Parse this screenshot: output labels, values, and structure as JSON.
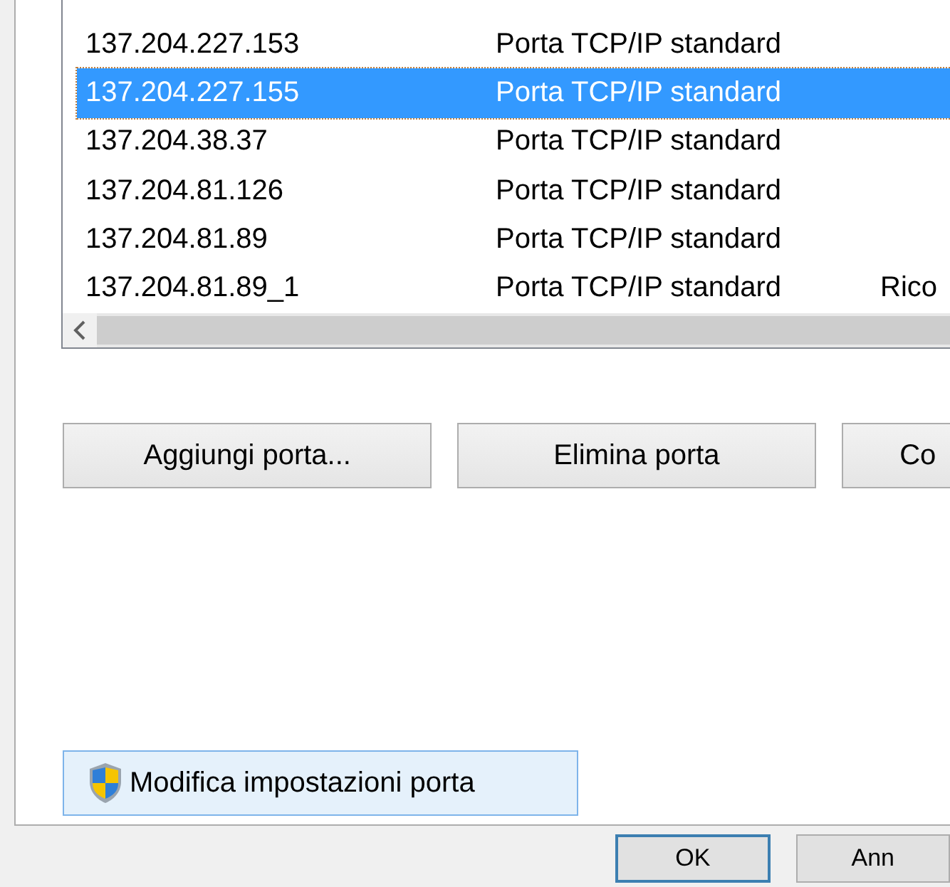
{
  "port_list": {
    "rows": [
      {
        "name": "137.204.227.153",
        "description": "Porta TCP/IP standard",
        "selected": false
      },
      {
        "name": "137.204.227.155",
        "description": "Porta TCP/IP standard",
        "selected": true
      },
      {
        "name": "137.204.38.37",
        "description": "Porta TCP/IP standard",
        "selected": false
      },
      {
        "name": "137.204.81.126",
        "description": "Porta TCP/IP standard",
        "selected": false
      },
      {
        "name": "137.204.81.89",
        "description": "Porta TCP/IP standard",
        "selected": false
      },
      {
        "name": "137.204.81.89_1",
        "description": "Porta TCP/IP standard",
        "column_3": "Rico",
        "selected": false
      }
    ]
  },
  "port_buttons": [
    "Aggiungi porta...",
    "Elimina porta",
    "Co"
  ],
  "settings_button": {
    "label": "Modifica impostazioni porta"
  },
  "dialog_buttons": [
    {
      "label": "OK",
      "default": true
    },
    {
      "label": "Ann",
      "default": false
    }
  ]
}
